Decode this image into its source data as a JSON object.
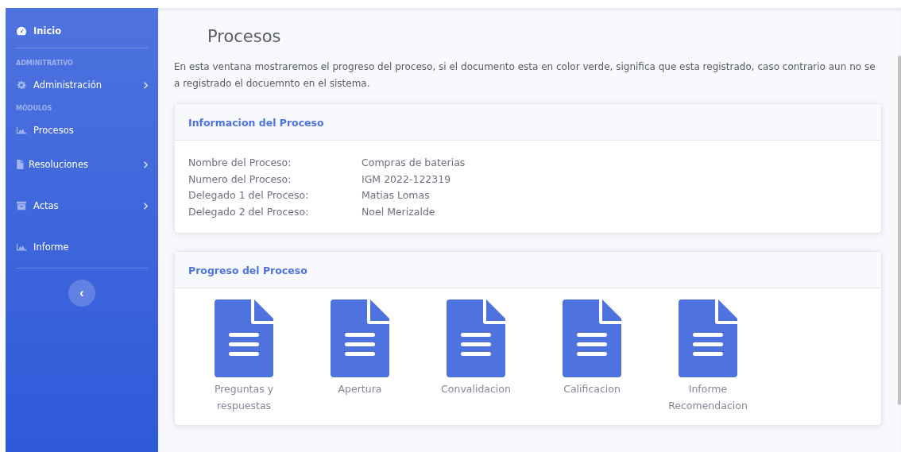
{
  "sidebar": {
    "items": [
      {
        "kind": "link",
        "label": "Inicio",
        "has_submenu": false,
        "divider_after": true
      },
      {
        "kind": "heading",
        "label": "ADMINITRATIVO"
      },
      {
        "kind": "link",
        "label": "Administración",
        "has_submenu": true,
        "divider_after": false
      },
      {
        "kind": "heading",
        "label": "MÓDULOS"
      },
      {
        "kind": "link",
        "label": "Procesos",
        "has_submenu": false,
        "divider_after": false
      },
      {
        "kind": "link",
        "label": "Resoluciones",
        "has_submenu": true,
        "divider_after": false
      },
      {
        "kind": "link",
        "label": "Actas",
        "has_submenu": true,
        "divider_after": false
      },
      {
        "kind": "link",
        "label": "Informe",
        "has_submenu": false,
        "divider_after": true
      }
    ],
    "toggle": "‹"
  },
  "page": {
    "title": "Procesos",
    "description": "En esta ventana mostraremos el progreso del proceso, si el documento esta en color verde, significa que esta registrado, caso contrario aun no se a registrado el docuemnto en el sistema."
  },
  "info_card": {
    "title": "Informacion del Proceso",
    "rows": [
      {
        "label": "Nombre del Proceso:",
        "value": "Compras de baterias"
      },
      {
        "label": "Numero del Proceso:",
        "value": "IGM 2022-122319"
      },
      {
        "label": "Delegado 1 del Proceso:",
        "value": "Matias Lomas"
      },
      {
        "label": "Delegado 2 del Proceso:",
        "value": "Noel Merizalde"
      }
    ]
  },
  "progress_card": {
    "title": "Progreso del Proceso",
    "steps": [
      {
        "label": "Preguntas y respuestas",
        "registered": false
      },
      {
        "label": "Apertura",
        "registered": false
      },
      {
        "label": "Convalidacion",
        "registered": false
      },
      {
        "label": "Calificacion",
        "registered": false
      },
      {
        "label": "Informe Recomendacion",
        "registered": false
      }
    ]
  }
}
